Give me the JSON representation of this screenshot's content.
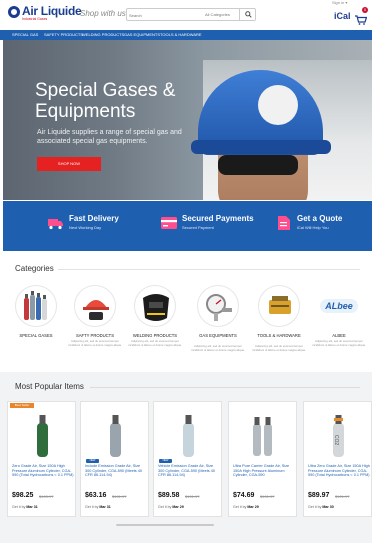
{
  "brand": {
    "name": "Air Liquide",
    "subtitle": "Industrial Gases",
    "tagline": "Shop with us",
    "accent": "#1f5fb0",
    "red": "#e52121"
  },
  "search": {
    "placeholder": "Search",
    "category": "All Categories"
  },
  "header": {
    "top_text": "Sign in ▾",
    "ical": "iCal",
    "cart_count": "0"
  },
  "nav": {
    "items": [
      "Special Gas",
      "Safety Products",
      "Welding Products",
      "Gas Equipments",
      "Tools & Hardware"
    ]
  },
  "hero": {
    "title": "Special Gases & Equipments",
    "subtitle": "Air Liquide supplies a range of special gas and associated special gas equipments.",
    "button": "Shop Now"
  },
  "features": [
    {
      "title": "Fast Delivery",
      "sub": "Next Working Day",
      "icon": "truck-icon"
    },
    {
      "title": "Secured Payments",
      "sub": "Secured Payment",
      "icon": "credit-card-icon"
    },
    {
      "title": "Get a Quote",
      "sub": "iCal Will Help You",
      "icon": "document-icon"
    }
  ],
  "categories": {
    "title": "Categories",
    "items": [
      {
        "name": "SPECIAL GASES",
        "desc": ""
      },
      {
        "name": "SAFTY PRODUCTS",
        "desc": "Adipiscing elit, sed do eiusmod tempor incididunt ut labore et dolore magna aliqua."
      },
      {
        "name": "WELDING PRODUCTS",
        "desc": "Adipiscing elit, sed do eiusmod tempor incididunt ut labore et dolore magna aliqua."
      },
      {
        "name": "GAS EQUIPMENTS",
        "desc": "Adipiscing elit, sed do eiusmod tempor incididunt ut labore et dolore magna aliqua."
      },
      {
        "name": "TOOLS & HARDWARE",
        "desc": "Adipiscing elit, sed do eiusmod tempor incididunt ut labore et dolore magna aliqua."
      },
      {
        "name": "ALBEE",
        "desc": "Adipiscing elit, sed do eiusmod tempor incididunt ut labore et dolore magna aliqua."
      }
    ],
    "albee_logo": "ALbee"
  },
  "popular": {
    "title": "Most Popular Items",
    "best_label": "Best Seller",
    "new_label": "NEW",
    "delivery_prefix": "Get it by",
    "products": [
      {
        "title": "Zero Grade Air, Size 150A High Pressure Aluminum Cylinder, CGA-590 (Total Hydrocarbons < 0.1 PPM)",
        "price": "$98.25",
        "old": "$103.97",
        "date": "Mar 31",
        "best": true,
        "badge": false,
        "cylinder_color": "#2f6e3c"
      },
      {
        "title": "Include Emission Grade Air, Size 300 Cylinder, CGA-590 (Meets 40 CFR 86.114-94)",
        "price": "$63.16",
        "old": "$101.97",
        "date": "Mar 31",
        "best": false,
        "badge": true,
        "cylinder_color": "#9aa4ac"
      },
      {
        "title": "Vehicle Emission Grade Air, Size 300 Cylinder, CGA-590 (Meets 40 CFR 86.114-94)",
        "price": "$89.58",
        "old": "$101.97",
        "date": "Mar 29",
        "best": false,
        "badge": true,
        "cylinder_color": "#c6d4dc"
      },
      {
        "title": "Ultra Pure Carrier Grade Air, Size 150A High Pressure Aluminum Cylinder, CGA-590",
        "price": "$74.69",
        "old": "$101.97",
        "date": "Mar 29",
        "best": false,
        "badge": false,
        "cylinder_color": "#b3bac0"
      },
      {
        "title": "Ultra Zero Grade Air, Size 150A High Pressure Aluminum Cylinder, CGA-590 (Total Hydrocarbons < 0.1 PPM)",
        "price": "$89.97",
        "old": "$101.97",
        "date": "Mar 30",
        "best": false,
        "badge": false,
        "cylinder_color": "#d4d7d9",
        "cylinder_label": "CO2"
      }
    ]
  }
}
